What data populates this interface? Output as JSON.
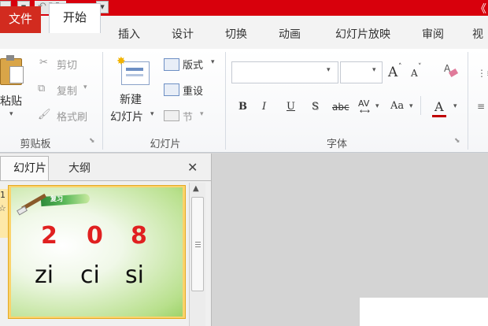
{
  "title_bar": {
    "right_glyph": "《"
  },
  "tabs": [
    "文件",
    "开始",
    "插入",
    "设计",
    "切换",
    "动画",
    "幻灯片放映",
    "审阅",
    "视"
  ],
  "clipboard": {
    "paste": "粘贴",
    "cut": "剪切",
    "copy": "复制",
    "format_painter": "格式刷",
    "group": "剪贴板"
  },
  "slides_group": {
    "new_slide_1": "新建",
    "new_slide_2": "幻灯片",
    "layout": "版式",
    "reset": "重设",
    "section": "节",
    "group": "幻灯片"
  },
  "font": {
    "family": "",
    "size": "",
    "grow": "A",
    "shrink": "A",
    "clear": "A",
    "bold": "B",
    "italic": "I",
    "underline": "U",
    "shadow": "S",
    "strike": "abc",
    "spacing": "AV",
    "case": "Aa",
    "color": "A",
    "group": "字体"
  },
  "panel": {
    "tab_slides": "幻灯片",
    "tab_outline": "大纲",
    "close": "✕",
    "slide_number": "1",
    "slide_star": "☆"
  },
  "slide1": {
    "banner_text": "复习",
    "numbers": [
      "2",
      "0",
      "8"
    ],
    "syllables": [
      "zi",
      "ci",
      "si"
    ]
  },
  "colors": {
    "title_bar": "#d8000c",
    "file_tab": "#d22b1f",
    "slide_border": "#fbd36b",
    "numbers_red": "#e02020"
  }
}
